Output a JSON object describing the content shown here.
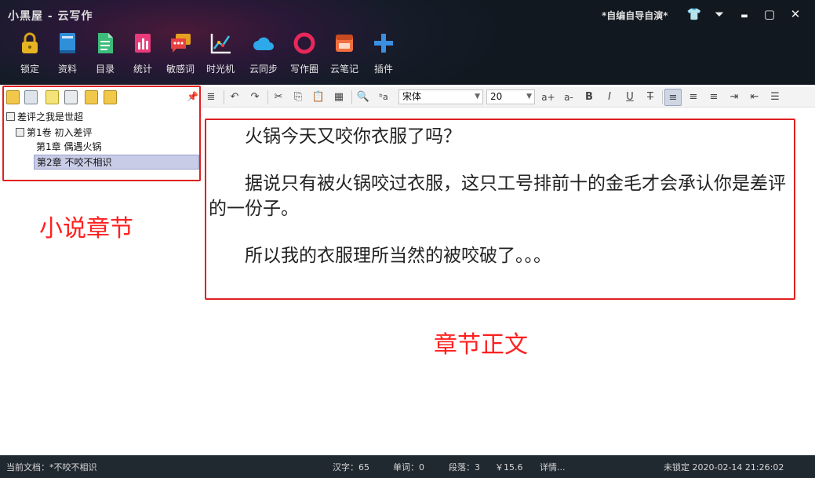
{
  "window": {
    "app_title": "小黑屋 - 云写作",
    "doc_title": "*自编自导自演*"
  },
  "window_controls": [
    {
      "icon": "shirt-icon",
      "glyph": "👕"
    },
    {
      "icon": "dropdown-icon",
      "glyph": "⏷"
    },
    {
      "icon": "minimize-icon",
      "glyph": "▬"
    },
    {
      "icon": "maximize-icon",
      "glyph": "▢"
    },
    {
      "icon": "close-icon",
      "glyph": "✕"
    }
  ],
  "toolbar": [
    {
      "label": "锁定",
      "icon": "lock-icon",
      "color": "#e6b422"
    },
    {
      "label": "资料",
      "icon": "book-icon",
      "color": "#2f8fd8"
    },
    {
      "label": "目录",
      "icon": "document-icon",
      "color": "#3dbb7a"
    },
    {
      "label": "统计",
      "icon": "stats-icon",
      "color": "#e83c7a"
    },
    {
      "label": "敏感词",
      "icon": "chat-icon",
      "color": "#e84040"
    },
    {
      "label": "时光机",
      "icon": "chart-icon",
      "color": "#f0f0f0"
    },
    {
      "label": "云同步",
      "icon": "cloud-icon",
      "color": "#2da8e8"
    },
    {
      "label": "写作圈",
      "icon": "ring-icon",
      "color": "#e8285a"
    },
    {
      "label": "云笔记",
      "icon": "note-icon",
      "color": "#f07040"
    },
    {
      "label": "插件",
      "icon": "plus-icon",
      "color": "#3a8fe0"
    }
  ],
  "tree": {
    "book": "差评之我是世超",
    "volume": "第1卷 初入差评",
    "chapters": [
      "第1章 偶遇火锅",
      "第2章 不咬不相识"
    ]
  },
  "annotations": {
    "left": "小说章节",
    "right": "章节正文"
  },
  "editor_toolbar": {
    "font": "宋体",
    "size": "20"
  },
  "editor": {
    "paragraphs": [
      "火锅今天又咬你衣服了吗？",
      "据说只有被火锅咬过衣服，这只工号排前十的金毛才会承认你是差评的一份子。",
      "所以我的衣服理所当然的被咬破了。。。"
    ]
  },
  "status": {
    "current_doc": "当前文档：*不咬不相识",
    "chars": "汉字：65",
    "words": "单词：0",
    "paras": "段落：3",
    "money": "￥15.6",
    "details": "详情...",
    "lock_time": "未锁定 2020-02-14  21:26:02"
  }
}
